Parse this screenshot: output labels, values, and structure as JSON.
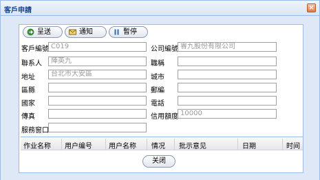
{
  "window": {
    "title": "客戶申請"
  },
  "toolbar": {
    "submit_label": "呈送",
    "notify_label": "通知",
    "pause_label": "暫停"
  },
  "form": {
    "customer_code_label": "客戶編號",
    "customer_code_value": "C019",
    "company_code_label": "公司編號",
    "company_code_value": "睿九股份有限公司",
    "contact_label": "聯系人",
    "contact_value": "陣英九",
    "title_label": "職稱",
    "title_value": "",
    "address_label": "地址",
    "address_value": "台北市大安區",
    "city_label": "城市",
    "city_value": "",
    "district_label": "區縣",
    "district_value": "",
    "postal_label": "郵編",
    "postal_value": "",
    "country_label": "國家",
    "country_value": "",
    "phone_label": "電話",
    "phone_value": "",
    "fax_label": "傳真",
    "fax_value": "",
    "credit_label": "信用額度",
    "credit_value": "10000",
    "service_label": "服務窗口",
    "service_value": ""
  },
  "grid": {
    "columns": [
      "作业名称",
      "用户编号",
      "用户名称",
      "情况",
      "批示意见",
      "日期",
      "时间"
    ]
  },
  "footer": {
    "close_label": "关闭"
  }
}
